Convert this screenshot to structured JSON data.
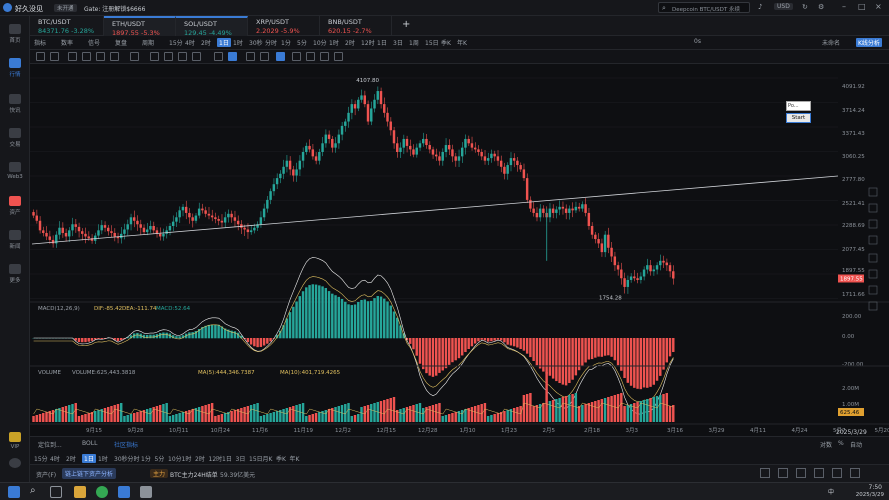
{
  "app": {
    "title": "好久没见",
    "status_badge": "未开通",
    "notice": "Gate: 注册解锁$6666"
  },
  "search": {
    "placeholder": "Deepcoin BTC/USDT 永续"
  },
  "currency": "USD",
  "tabs": [
    {
      "name": "BTC/USDT",
      "price": "84371.76",
      "change": "-3.28%"
    },
    {
      "name": "ETH/USDT",
      "price": "1897.55",
      "change": "-5.3%"
    },
    {
      "name": "SOL/USDT",
      "price": "129.45",
      "change": "-4.49%"
    },
    {
      "name": "XRP/USDT",
      "price": "2.2029",
      "change": "-5.9%"
    },
    {
      "name": "BNB/USDT",
      "price": "620.15",
      "change": "-2.7%"
    }
  ],
  "sidebar": [
    {
      "label": "首页"
    },
    {
      "label": "行情"
    },
    {
      "label": "快讯"
    },
    {
      "label": "交易"
    },
    {
      "label": "Web3"
    },
    {
      "label": "资产"
    },
    {
      "label": "新闻"
    },
    {
      "label": "更多"
    },
    {
      "label": "VIP"
    }
  ],
  "toolbar1": {
    "items": [
      "指标",
      "数率",
      "信号",
      "复盘",
      "周期",
      "15分",
      "4时",
      "2时",
      "1日",
      "1时",
      "30秒",
      "分时",
      "1分",
      "5分",
      "10分",
      "1时",
      "2时",
      "12时",
      "1日",
      "3日",
      "1周",
      "15日",
      "季K",
      "年K"
    ],
    "selected": "1日",
    "right": [
      "0s",
      "未命名",
      "K线分析"
    ]
  },
  "chart_data": {
    "type": "candlestick",
    "symbol": "ETH/USDT",
    "interval": "1日",
    "price_axis": [
      "4091.92",
      "3714.24",
      "3371.43",
      "3060.25",
      "2777.80",
      "2521.41",
      "2288.69",
      "2077.45",
      "1897.55",
      "1711.66"
    ],
    "date_axis": [
      "9月15",
      "9月28",
      "10月11",
      "10月24",
      "11月6",
      "11月19",
      "12月2",
      "12月15",
      "12月28",
      "1月10",
      "1月23",
      "2月5",
      "2月18",
      "3月3",
      "3月16",
      "3月29",
      "4月11",
      "4月24",
      "5月7",
      "5月20"
    ],
    "annotations": [
      {
        "text": "4107.80"
      },
      {
        "text": "1754.28"
      }
    ],
    "current_price": "1897.55",
    "close_series": [
      2620,
      2560,
      2450,
      2420,
      2380,
      2340,
      2300,
      2400,
      2480,
      2420,
      2380,
      2450,
      2520,
      2490,
      2440,
      2410,
      2380,
      2360,
      2330,
      2390,
      2450,
      2510,
      2480,
      2440,
      2420,
      2380,
      2360,
      2410,
      2460,
      2520,
      2600,
      2560,
      2520,
      2480,
      2430,
      2460,
      2500,
      2450,
      2410,
      2380,
      2410,
      2450,
      2500,
      2550,
      2600,
      2680,
      2720,
      2650,
      2600,
      2560,
      2620,
      2700,
      2680,
      2640,
      2620,
      2600,
      2580,
      2560,
      2540,
      2600,
      2640,
      2600,
      2560,
      2520,
      2480,
      2460,
      2430,
      2450,
      2480,
      2520,
      2600,
      2700,
      2800,
      2900,
      2980,
      3050,
      3100,
      3180,
      3250,
      3150,
      3080,
      3150,
      3250,
      3350,
      3420,
      3380,
      3300,
      3250,
      3350,
      3450,
      3550,
      3500,
      3400,
      3450,
      3550,
      3650,
      3700,
      3800,
      3900,
      3850,
      3950,
      4000,
      3900,
      3700,
      3850,
      3950,
      4050,
      3900,
      3800,
      3700,
      3600,
      3450,
      3350,
      3400,
      3500,
      3420,
      3380,
      3320,
      3400,
      3450,
      3500,
      3430,
      3380,
      3320,
      3300,
      3250,
      3350,
      3430,
      3380,
      3300,
      3250,
      3300,
      3400,
      3500,
      3450,
      3400,
      3380,
      3350,
      3300,
      3250,
      3280,
      3330,
      3300,
      3250,
      3180,
      3100,
      3200,
      3280,
      3250,
      3200,
      3150,
      3050,
      2800,
      2700,
      2650,
      2600,
      2700,
      2650,
      2600,
      2700,
      2650,
      2690,
      2720,
      2700,
      2650,
      2700,
      2680,
      2720,
      2700,
      2750,
      2650,
      2500,
      2400,
      2350,
      2300,
      2200,
      2400,
      2250,
      2150,
      2050,
      2000,
      1900,
      1800,
      1880,
      1920,
      1900,
      1880,
      1920,
      2000,
      2050,
      1980,
      2000,
      2050,
      2100,
      2080,
      2050,
      1980,
      1897
    ],
    "trendline": true,
    "macd": {
      "label": "MACD(12,26,9)",
      "dif": "DIF:-85.42",
      "dea": "DEA:-111.74",
      "macd": "MACD:52.64",
      "axis": [
        "200.00",
        "0.00",
        "-200.00"
      ]
    },
    "volume": {
      "label": "VOLUME",
      "value": "VOLUME:625,443.3818",
      "ma5": "MA(5):444,346.7387",
      "ma10": "MA(10):401,719.4265",
      "axis": [
        "2.00M",
        "1.00M"
      ],
      "current": "625.46"
    }
  },
  "popup": {
    "field": "Po...",
    "button": "Start"
  },
  "bottom": {
    "tabs": [
      "定位到...",
      "BOLL",
      "社区指标"
    ],
    "right": [
      "对数",
      "%",
      "自动"
    ],
    "intervals": [
      "15分",
      "4时",
      "2时",
      "1日",
      "1时",
      "30秒",
      "分时",
      "1分",
      "5分",
      "10分",
      "1时",
      "2时",
      "12时",
      "1日",
      "3日",
      "15日",
      "月K",
      "季K",
      "年K"
    ],
    "selected": "1日",
    "date": "2025/3/29"
  },
  "assetbar": {
    "label": "资产(F)",
    "link": "链上链下资产分析",
    "tag": "主力",
    "text": "BTC主力24H结单",
    "value": "59.39亿美元"
  },
  "taskbar": {
    "time": "7:50",
    "date": "2025/3/29",
    "lang": "中"
  }
}
